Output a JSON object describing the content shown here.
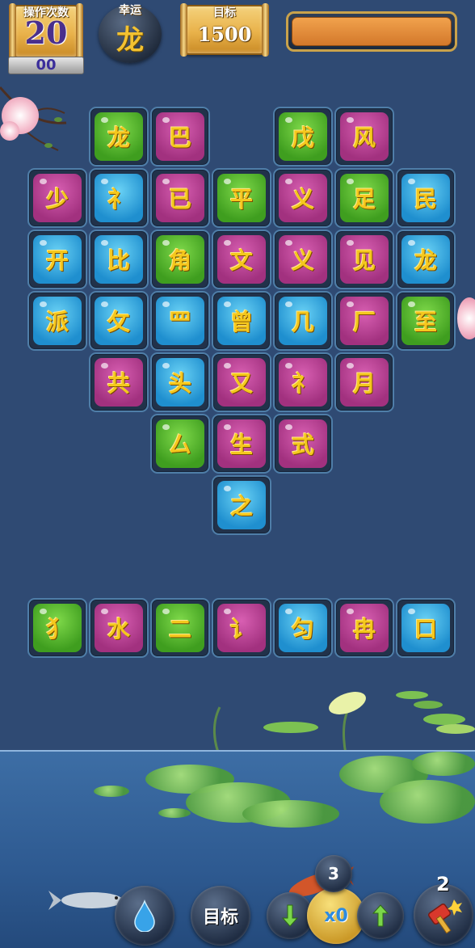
{
  "hud": {
    "moves": {
      "caption": "操作次数",
      "value": "20",
      "bar_text": "00"
    },
    "lucky": {
      "caption": "幸运",
      "char": "龙"
    },
    "target": {
      "caption": "目标",
      "value": "1500"
    },
    "progress_fraction": 1.0
  },
  "colors": {
    "green": "#4fb52b",
    "pink": "#b8408f",
    "blue": "#2ea6e0",
    "gold": "#f5c81d",
    "background": "#2f4a73"
  },
  "board": {
    "rows": [
      [
        {
          "col": 1,
          "char": "龙",
          "color": "green"
        },
        {
          "col": 2,
          "char": "巴",
          "color": "pink"
        },
        {
          "col": 4,
          "char": "戊",
          "color": "green"
        },
        {
          "col": 5,
          "char": "风",
          "color": "pink"
        }
      ],
      [
        {
          "col": 0,
          "char": "少",
          "color": "pink"
        },
        {
          "col": 1,
          "char": "礻",
          "color": "blue"
        },
        {
          "col": 2,
          "char": "已",
          "color": "pink"
        },
        {
          "col": 3,
          "char": "平",
          "color": "green"
        },
        {
          "col": 4,
          "char": "义",
          "color": "pink"
        },
        {
          "col": 5,
          "char": "足",
          "color": "green"
        },
        {
          "col": 6,
          "char": "民",
          "color": "blue"
        }
      ],
      [
        {
          "col": 0,
          "char": "开",
          "color": "blue"
        },
        {
          "col": 1,
          "char": "比",
          "color": "blue"
        },
        {
          "col": 2,
          "char": "角",
          "color": "green"
        },
        {
          "col": 3,
          "char": "文",
          "color": "pink"
        },
        {
          "col": 4,
          "char": "义",
          "color": "pink"
        },
        {
          "col": 5,
          "char": "见",
          "color": "pink"
        },
        {
          "col": 6,
          "char": "龙",
          "color": "blue"
        }
      ],
      [
        {
          "col": 0,
          "char": "派",
          "color": "blue"
        },
        {
          "col": 1,
          "char": "攵",
          "color": "blue"
        },
        {
          "col": 2,
          "char": "罒",
          "color": "blue"
        },
        {
          "col": 3,
          "char": "曾",
          "color": "blue"
        },
        {
          "col": 4,
          "char": "几",
          "color": "blue"
        },
        {
          "col": 5,
          "char": "厂",
          "color": "pink"
        },
        {
          "col": 6,
          "char": "至",
          "color": "green"
        }
      ],
      [
        {
          "col": 1,
          "char": "共",
          "color": "pink"
        },
        {
          "col": 2,
          "char": "头",
          "color": "blue"
        },
        {
          "col": 3,
          "char": "又",
          "color": "pink"
        },
        {
          "col": 4,
          "char": "礻",
          "color": "pink"
        },
        {
          "col": 5,
          "char": "月",
          "color": "pink"
        }
      ],
      [
        {
          "col": 2,
          "char": "厶",
          "color": "green"
        },
        {
          "col": 3,
          "char": "生",
          "color": "pink"
        },
        {
          "col": 4,
          "char": "式",
          "color": "pink"
        }
      ],
      [
        {
          "col": 3,
          "char": "之",
          "color": "blue"
        }
      ]
    ]
  },
  "queue": [
    {
      "char": "犭",
      "color": "green"
    },
    {
      "char": "水",
      "color": "pink"
    },
    {
      "char": "二",
      "color": "green"
    },
    {
      "char": "讠",
      "color": "pink"
    },
    {
      "char": "匀",
      "color": "blue"
    },
    {
      "char": "冉",
      "color": "pink"
    },
    {
      "char": "口",
      "color": "blue"
    }
  ],
  "toolbar": {
    "water_icon": "water-drop-icon",
    "target_label": "目标",
    "arrow_down_icon": "arrow-down-icon",
    "multiplier_label": "x0",
    "multiplier_badge": "3",
    "arrow_up_icon": "arrow-up-icon",
    "hammer_icon": "hammer-icon",
    "hammer_badge": "2"
  }
}
